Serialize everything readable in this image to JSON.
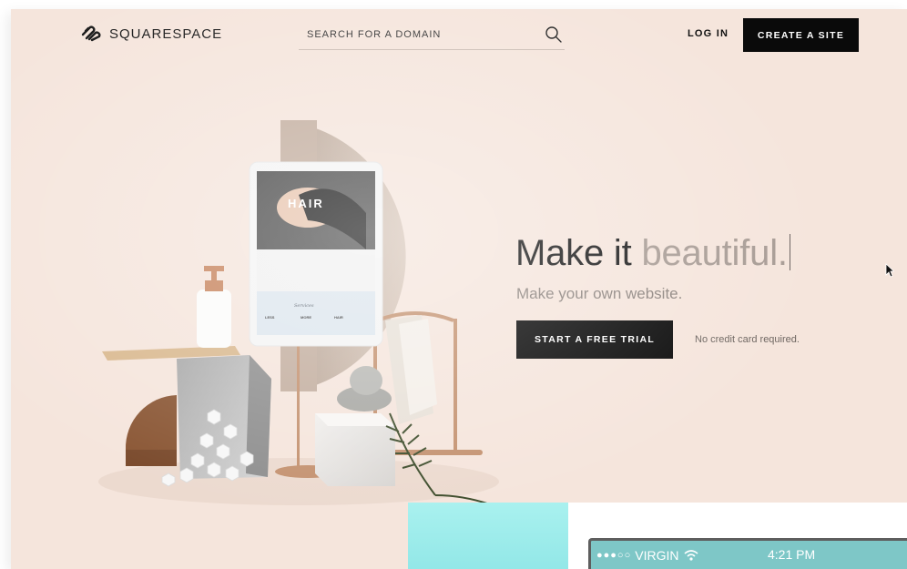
{
  "brand": {
    "name": "SQUARESPACE"
  },
  "header": {
    "search_placeholder": "SEARCH FOR A DOMAIN",
    "login_label": "LOG IN",
    "create_label": "CREATE A SITE"
  },
  "hero": {
    "headline_lead": "Make it",
    "headline_accent": "beautiful.",
    "subhead": "Make your own website.",
    "cta_label": "START A FREE TRIAL",
    "note": "No credit card required."
  },
  "tablet": {
    "title": "HAIR",
    "menu_heading": "Services",
    "menu_cols": [
      "LESS",
      "MORE",
      "HAIR"
    ]
  },
  "preview": {
    "signal": "●●●○○",
    "carrier": "VIRGIN",
    "time": "4:21 PM"
  },
  "icons": {
    "logo": "squarespace-logo-icon",
    "search": "search-icon",
    "wifi": "wifi-icon",
    "cursor": "cursor-icon"
  },
  "colors": {
    "background": "#f5e5dc",
    "button": "#0a0a0a",
    "accent_text": "#a89c95",
    "preview_teal": "#a9f1ef"
  }
}
